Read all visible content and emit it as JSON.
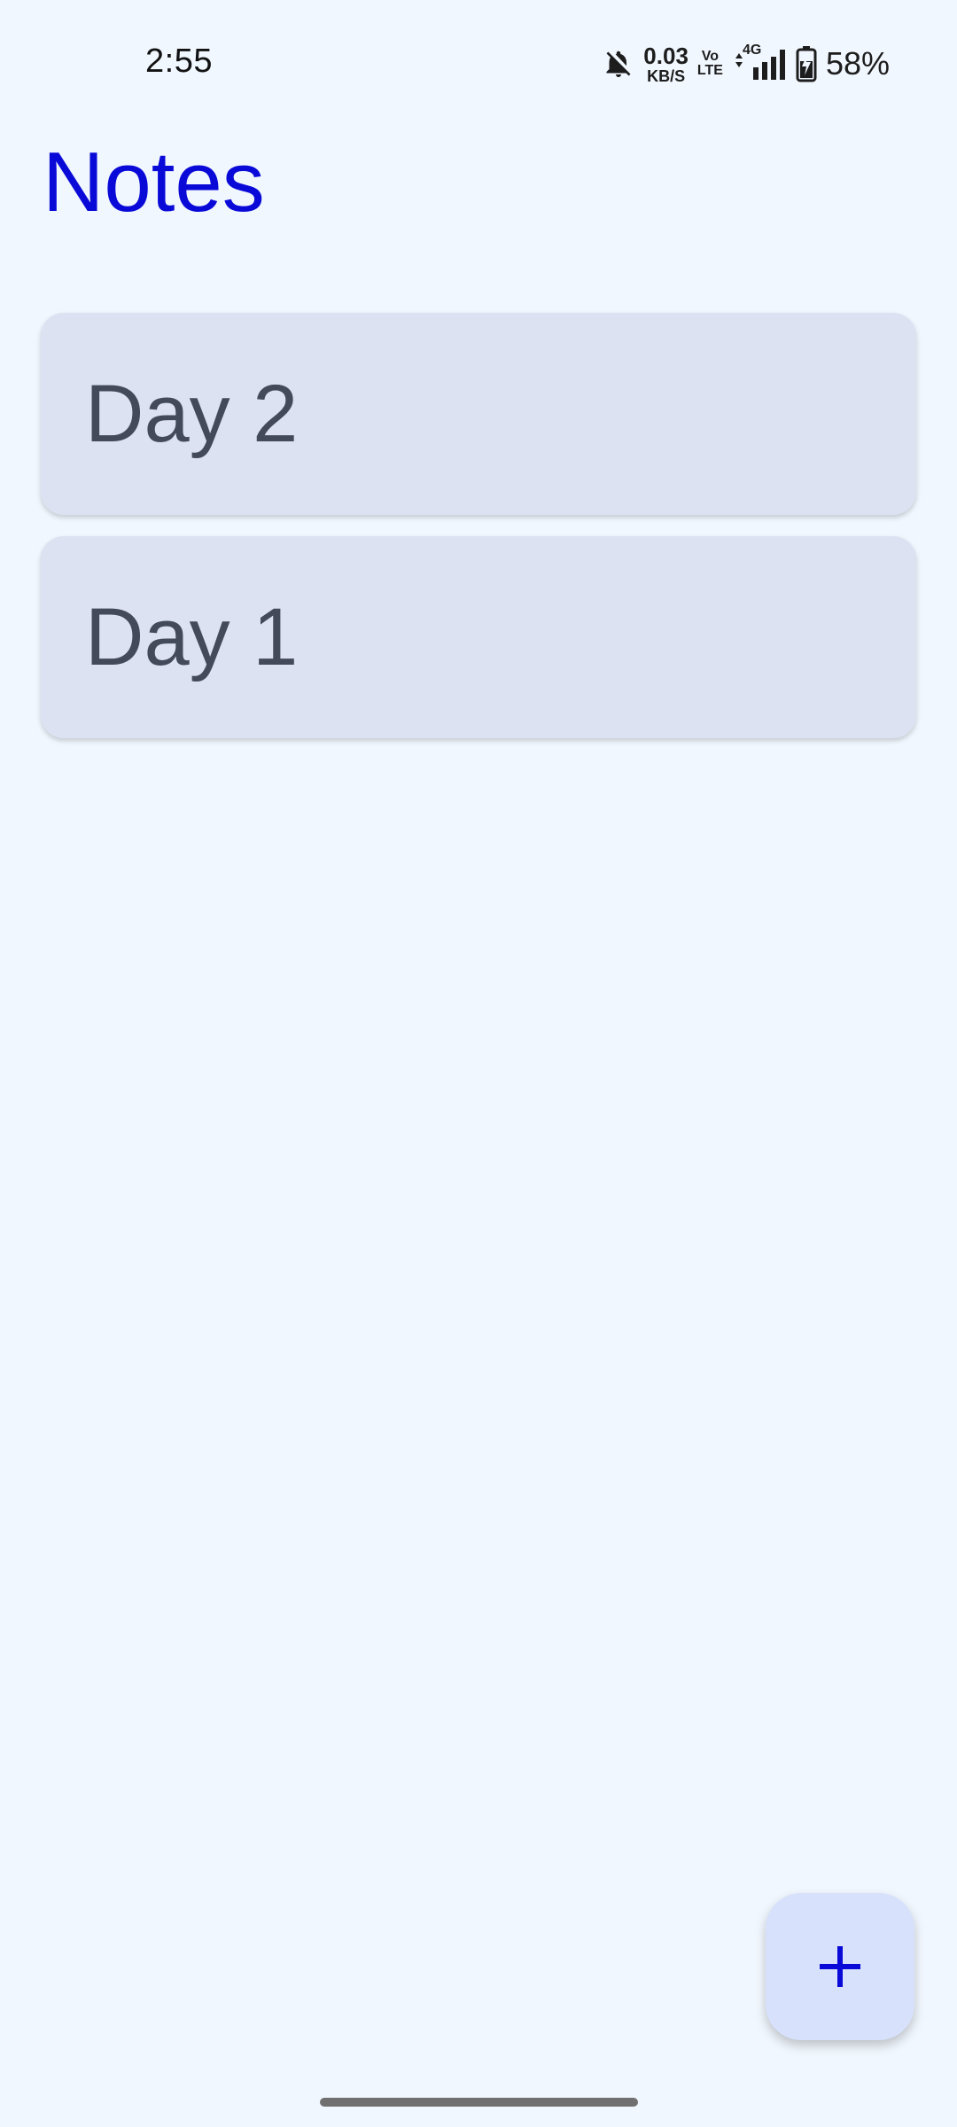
{
  "status_bar": {
    "time": "2:55",
    "net_speed_value": "0.03",
    "net_speed_unit": "KB/S",
    "volte_top": "Vo",
    "volte_bottom": "LTE",
    "network_type": "4G",
    "battery_percent": "58%",
    "icons": [
      "bell-off-icon",
      "signal-icon",
      "battery-charging-icon"
    ]
  },
  "header": {
    "title": "Notes",
    "title_color": "#0a0ad8"
  },
  "notes": [
    {
      "title": "Day 2"
    },
    {
      "title": "Day 1"
    }
  ],
  "fab": {
    "icon": "plus-icon",
    "accent": "#0a0ad8",
    "background": "#d7e1fb"
  },
  "colors": {
    "background": "#f1f7fe",
    "card": "#dde2f2",
    "card_text": "#434a5a"
  }
}
